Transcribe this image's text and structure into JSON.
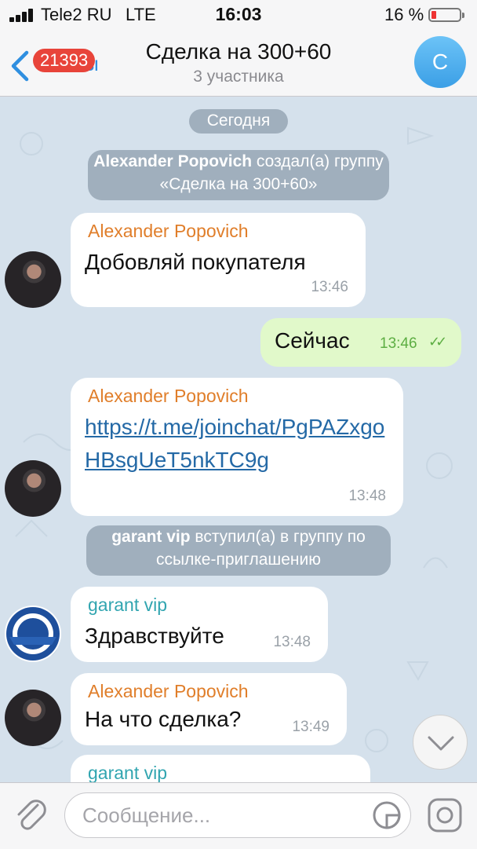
{
  "status_bar": {
    "carrier": "Tele2 RU",
    "network": "LTE",
    "time": "16:03",
    "battery_percent": "16 %",
    "battery_color": "#e33333"
  },
  "nav": {
    "back_label": "Чаты",
    "unread_badge": "21393",
    "title": "Сделка на 300+60",
    "subtitle": "3 участника",
    "avatar_letter": "С"
  },
  "chat": {
    "date_divider": "Сегодня",
    "service_created": {
      "actor": "Alexander Popovich",
      "text": " создал(а) группу «Сделка на 300+60»"
    },
    "messages": [
      {
        "sender": "Alexander Popovich",
        "text": "Добовляй покупателя",
        "time": "13:46"
      },
      {
        "text": "Сейчас",
        "time": "13:46"
      },
      {
        "sender": "Alexander Popovich",
        "link": "https://t.me/joinchat/PgPAZxgoHBsgUeT5nkTC9g",
        "time": "13:48"
      },
      {
        "sender": "garant vip",
        "text": "Здравствуйте",
        "time": "13:48"
      },
      {
        "sender": "Alexander Popovich",
        "text": "На что сделка?",
        "time": "13:49"
      },
      {
        "sender": "garant vip"
      }
    ],
    "service_joined": {
      "actor": "garant vip",
      "text": " вступил(а) в группу по ссылке-приглашению"
    }
  },
  "input": {
    "placeholder": "Сообщение..."
  },
  "colors": {
    "accent": "#2f8fe0",
    "outgoing_bubble": "#e1f9ca",
    "sender_orange": "#e07e2a",
    "sender_teal": "#31a5b0"
  }
}
